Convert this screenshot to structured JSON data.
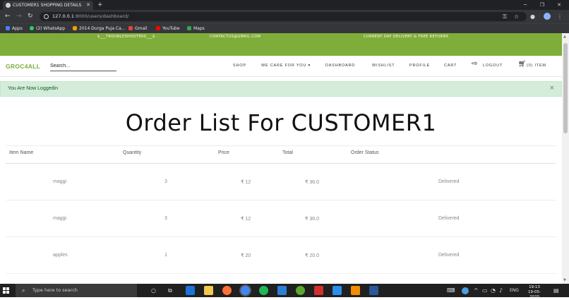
{
  "browser": {
    "tab_title": "CUSTOMER1 SHOPPING DETAILS",
    "url_host": "127.0.0.1",
    "url_path": ":8000/users/dashboard/",
    "bookmarks": [
      {
        "label": "Apps",
        "color": "#4285f4"
      },
      {
        "label": "(2) WhatsApp",
        "color": "#25d366"
      },
      {
        "label": "2014 Durga Puja Ca...",
        "color": "#f4a000"
      },
      {
        "label": "Gmail",
        "color": "#ea4335"
      },
      {
        "label": "YouTube",
        "color": "#ff0000"
      },
      {
        "label": "Maps",
        "color": "#34a853"
      }
    ]
  },
  "site": {
    "strip": {
      "left": "$___TROUBLESHOOTERS___$",
      "email": "CONTACTUS@GMAIL.COM",
      "delivery": "CURRENT DAY DELIVERY & FREE RETURNS"
    },
    "brand": "GROC4ALL",
    "search_placeholder": "Search...",
    "nav": {
      "shop": "SHOP",
      "we_care": "WE CARE FOR YOU",
      "dashboard": "DASHBOARD",
      "wishlist": "WISHLIST",
      "profile": "PROFILE",
      "cart": "CART",
      "logout": "LOGOUT",
      "items": "(0) ITEM"
    },
    "alert": "You Are Now Loggedin",
    "heading": "Order List For CUSTOMER1",
    "table": {
      "headers": [
        "Item Name",
        "Quantity",
        "Price",
        "Total",
        "Order Status"
      ],
      "rows": [
        [
          "maggi",
          "3",
          "₹ 12",
          "₹ 36.0",
          "Delivered"
        ],
        [
          "maggi",
          "3",
          "₹ 12",
          "₹ 36.0",
          "Delivered"
        ],
        [
          "apples",
          "1",
          "₹ 20",
          "₹ 20.0",
          "Delivered"
        ]
      ]
    }
  },
  "taskbar": {
    "search_placeholder": "Type here to search",
    "lang": "ENG",
    "time": "19:13",
    "date": "19-05-2020"
  },
  "colors": {
    "brand_green": "#7fad39",
    "alert_bg": "#d4edda",
    "alert_text": "#155724"
  }
}
